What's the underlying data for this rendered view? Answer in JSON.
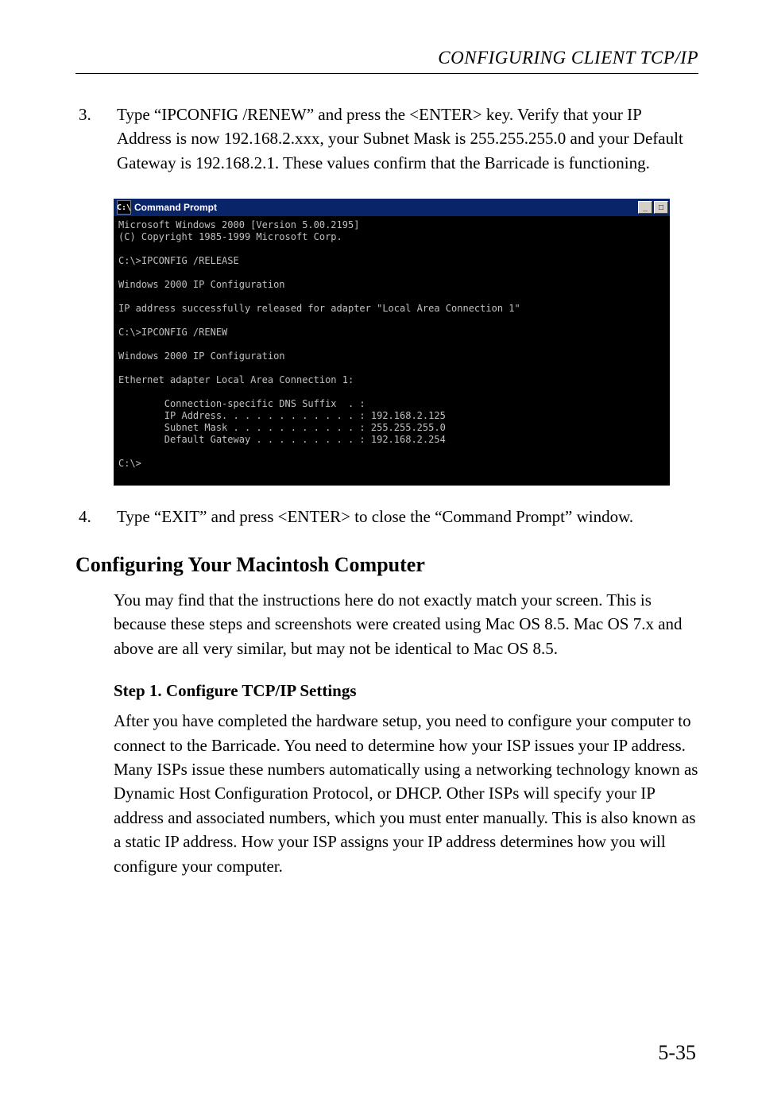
{
  "running_head": "CONFIGURING CLIENT TCP/IP",
  "steps_a": [
    {
      "num": "3.",
      "text": "Type “IPCONFIG /RENEW” and press the <ENTER> key. Verify that your IP Address is now 192.168.2.xxx, your Subnet Mask is 255.255.255.0 and your Default Gateway is 192.168.2.1. These values confirm that the Barricade is functioning."
    }
  ],
  "cmd_window": {
    "title_icon": "C:\\",
    "title": "Command Prompt",
    "lines": "Microsoft Windows 2000 [Version 5.00.2195]\n(C) Copyright 1985-1999 Microsoft Corp.\n\nC:\\>IPCONFIG /RELEASE\n\nWindows 2000 IP Configuration\n\nIP address successfully released for adapter \"Local Area Connection 1\"\n\nC:\\>IPCONFIG /RENEW\n\nWindows 2000 IP Configuration\n\nEthernet adapter Local Area Connection 1:\n\n        Connection-specific DNS Suffix  . :\n        IP Address. . . . . . . . . . . . : 192.168.2.125\n        Subnet Mask . . . . . . . . . . . : 255.255.255.0\n        Default Gateway . . . . . . . . . : 192.168.2.254\n\nC:\\>"
  },
  "steps_b": [
    {
      "num": "4.",
      "text": "Type “EXIT” and press <ENTER> to close the “Command Prompt” window."
    }
  ],
  "section_heading": "Configuring Your Macintosh Computer",
  "section_body": "You may find that the instructions here do not exactly match your screen. This is because these steps and screenshots were created using Mac OS 8.5. Mac OS 7.x and above are all very similar, but may not be identical to Mac OS 8.5.",
  "substep_heading": "Step 1. Configure TCP/IP Settings",
  "substep_body": "After you have completed the hardware setup, you need to configure your computer to connect to the Barricade. You need to determine how your ISP issues your IP address. Many ISPs issue these numbers automatically using a networking technology known as Dynamic Host Configuration Protocol, or DHCP. Other ISPs will specify your IP address and associated numbers, which you must enter manually. This is also known as a static IP address. How your ISP assigns your IP address determines how you will configure your computer.",
  "folio": "5-35",
  "window_controls": {
    "min": "_",
    "max": "□"
  }
}
